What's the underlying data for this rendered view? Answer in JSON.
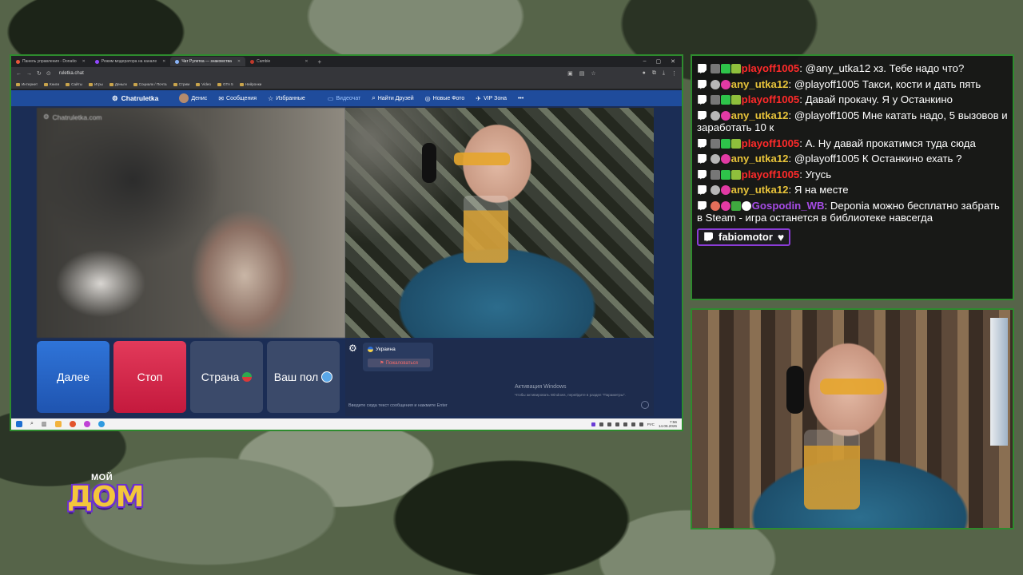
{
  "browser": {
    "tabs": [
      {
        "label": "Панель управления - Donatio",
        "active": false
      },
      {
        "label": "Режим модератора на канале",
        "active": false
      },
      {
        "label": "Чат Рулетка — знакомства",
        "active": true
      },
      {
        "label": "Cambie",
        "active": false
      }
    ],
    "url": "ruletka.chat",
    "bookmarks": [
      "Интернет",
      "Книги",
      "Сайты",
      "Игры",
      "Деньги",
      "Социалк / Почта",
      "Стрим",
      "Video",
      "GTA 5",
      "Нейронки"
    ]
  },
  "site": {
    "brand": "Chatruletka",
    "nav": {
      "user": "Денис",
      "messages": "Сообщения",
      "favorites": "Избранные",
      "videochat": "Видеочат",
      "find_friends": "Найти Друзей",
      "new_photos": "Новые Фото",
      "vip": "VIP Зона",
      "more": "•••"
    },
    "watermark": "Chatruletka.com",
    "buttons": {
      "next": "Далее",
      "stop": "Стоп",
      "country": "Страна",
      "sex": "Ваш пол"
    },
    "partner_country": "Украина",
    "complain": "Пожаловаться",
    "message_placeholder": "Введите сюда текст сообщения и нажмите Enter",
    "activation_title": "Активация Windows",
    "activation_sub": "Чтобы активировать Windows, перейдите в раздел \"Параметры\"."
  },
  "taskbar": {
    "lang": "РУС",
    "time": "7:56",
    "date": "14.06.2026"
  },
  "chat": {
    "messages": [
      {
        "nick": "playoff1005",
        "color": "red",
        "text": "@any_utka12 хз. Тебе надо что?"
      },
      {
        "nick": "any_utka12",
        "color": "gold",
        "text": "@playoff1005 Такси, кости и дать пять"
      },
      {
        "nick": "playoff1005",
        "color": "red",
        "text": "Давай прокачу. Я у Останкино"
      },
      {
        "nick": "any_utka12",
        "color": "gold",
        "text": "@playoff1005 Мне катать надо, 5 вызовов и заработать 10 к"
      },
      {
        "nick": "playoff1005",
        "color": "red",
        "text": "А. Ну давай прокатимся туда сюда"
      },
      {
        "nick": "any_utka12",
        "color": "gold",
        "text": "@playoff1005 К Останкино ехать ?"
      },
      {
        "nick": "playoff1005",
        "color": "red",
        "text": "Угусь"
      },
      {
        "nick": "any_utka12",
        "color": "gold",
        "text": "Я на месте"
      },
      {
        "nick": "Gospodin_WB",
        "color": "purple",
        "text": "Deponia можно бесплатно забрать в Steam - игра останется в библиотеке навсегда"
      }
    ],
    "follower": "fabiomotor"
  },
  "logo": {
    "small": "МОЙ",
    "main": "ДОМ"
  },
  "colors": {
    "frame": "#2e8b2e",
    "next_button": "#2f74d8",
    "stop_button": "#e23a5a",
    "site_nav": "#1f4c9c"
  }
}
